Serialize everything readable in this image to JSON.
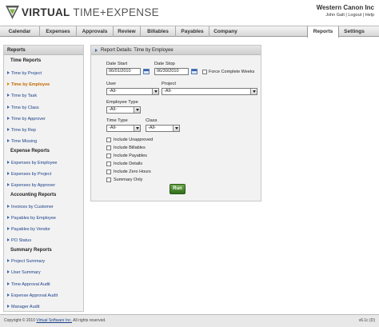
{
  "header": {
    "brand_main": "VIRTUAL",
    "brand_rest": "TIME+EXPENSE",
    "company": "Western Canon Inc",
    "user": "John Galt",
    "logout": "Logout",
    "help": "Help",
    "sep": "|"
  },
  "nav": {
    "tabs": [
      "Calendar",
      "Expenses",
      "Approvals",
      "Review",
      "Billables",
      "Payables",
      "Company"
    ],
    "reports": "Reports",
    "settings": "Settings"
  },
  "sidebar": {
    "title": "Reports",
    "sections": [
      {
        "title": "Time Reports",
        "items": [
          "Time by Project",
          "Time by Employee",
          "Time by Task",
          "Time by Class",
          "Time by Approver",
          "Time by Rep",
          "Time Missing"
        ]
      },
      {
        "title": "Expense Reports",
        "items": [
          "Expenses by Employee",
          "Expenses by Project",
          "Expenses by Approver"
        ]
      },
      {
        "title": "Accounting Reports",
        "items": [
          "Invoices by Customer",
          "Payables by Employee",
          "Payables by Vendor",
          "PO Status"
        ]
      },
      {
        "title": "Summary Reports",
        "items": [
          "Project Summary",
          "User Summary",
          "Time Approval Audit",
          "Expense Approval Audit",
          "Manager Audit"
        ]
      }
    ]
  },
  "panel": {
    "title": "Report Details: Time by Employee",
    "date_start_label": "Date Start",
    "date_start": "06/01/2010",
    "date_stop_label": "Date Stop",
    "date_stop": "06/30/2010",
    "force_label": "Force Complete Weeks",
    "user_label": "User",
    "user_value": "-All-",
    "project_label": "Project",
    "project_value": "-All-",
    "employee_type_label": "Employee Type",
    "employee_type_value": "-All-",
    "time_type_label": "Time Type",
    "time_type_value": "-All-",
    "class_label": "Class",
    "class_value": "-All-",
    "checkboxes": [
      "Include Unapproved",
      "Include Billables",
      "Include Payables",
      "Include Details",
      "Include Zero Hours",
      "Summary Only"
    ],
    "run_label": "Run"
  },
  "footer": {
    "copy_prefix": "Copyright © 2010",
    "copy_link": "Virtual Software Inc.",
    "copy_suffix": "All rights reserved.",
    "version": "v6.1c (D)"
  }
}
